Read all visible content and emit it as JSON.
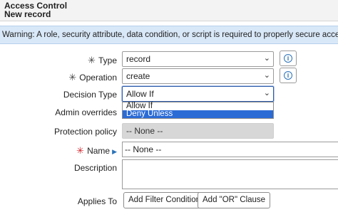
{
  "header": {
    "title": "Access Control",
    "subtitle": "New record"
  },
  "warning": "Warning: A role, security attribute, data condition, or script is required to properly secure access with this ACL.",
  "form": {
    "type": {
      "label": "Type",
      "value": "record"
    },
    "operation": {
      "label": "Operation",
      "value": "create"
    },
    "decision_type": {
      "label": "Decision Type",
      "value": "Allow If",
      "options": [
        "Allow If",
        "Deny Unless"
      ]
    },
    "admin_overrides": {
      "label": "Admin overrides"
    },
    "protection_policy": {
      "label": "Protection policy",
      "value": "-- None --"
    },
    "name": {
      "label": "Name",
      "value": "-- None --"
    },
    "description": {
      "label": "Description",
      "value": ""
    },
    "applies_to": {
      "label": "Applies To",
      "add_filter_label": "Add Filter Condition",
      "add_or_label": "Add \"OR\" Clause"
    }
  },
  "icons": {
    "required": "asterisk-icon",
    "info": "info-icon",
    "chevron": "chevron-down-icon",
    "reference": "reference-arrow-icon"
  },
  "colors": {
    "warning_bg": "#d9e8f8",
    "required_red": "#d0282f",
    "info_blue": "#2c73b8",
    "selected_option": "#2b6bd6"
  }
}
